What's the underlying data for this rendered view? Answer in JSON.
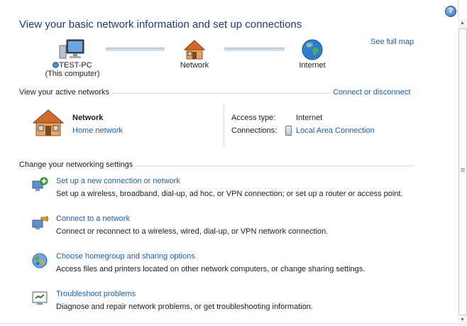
{
  "page": {
    "title": "View your basic network information and set up connections",
    "see_full_map": "See full map",
    "help": "?"
  },
  "map": {
    "computer_name": "TEST-PC",
    "computer_sub": "(This computer)",
    "network": "Network",
    "internet": "Internet"
  },
  "active": {
    "section_label": "View your active networks",
    "connect_link": "Connect or disconnect",
    "network_name": "Network",
    "network_type": "Home network",
    "access_type_label": "Access type:",
    "access_type_value": "Internet",
    "connections_label": "Connections:",
    "connections_value": "Local Area Connection"
  },
  "settings": {
    "section_label": "Change your networking settings",
    "tasks": [
      {
        "title": "Set up a new connection or network",
        "desc": "Set up a wireless, broadband, dial-up, ad hoc, or VPN connection; or set up a router or access point.",
        "icon": "new-connection-icon"
      },
      {
        "title": "Connect to a network",
        "desc": "Connect or reconnect to a wireless, wired, dial-up, or VPN network connection.",
        "icon": "connect-network-icon"
      },
      {
        "title": "Choose homegroup and sharing options",
        "desc": "Access files and printers located on other network computers, or change sharing settings.",
        "icon": "homegroup-icon"
      },
      {
        "title": "Troubleshoot problems",
        "desc": "Diagnose and repair network problems, or get troubleshooting information.",
        "icon": "troubleshoot-icon"
      }
    ]
  },
  "colors": {
    "link": "#1f5bb0",
    "title": "#1e3a7b"
  }
}
